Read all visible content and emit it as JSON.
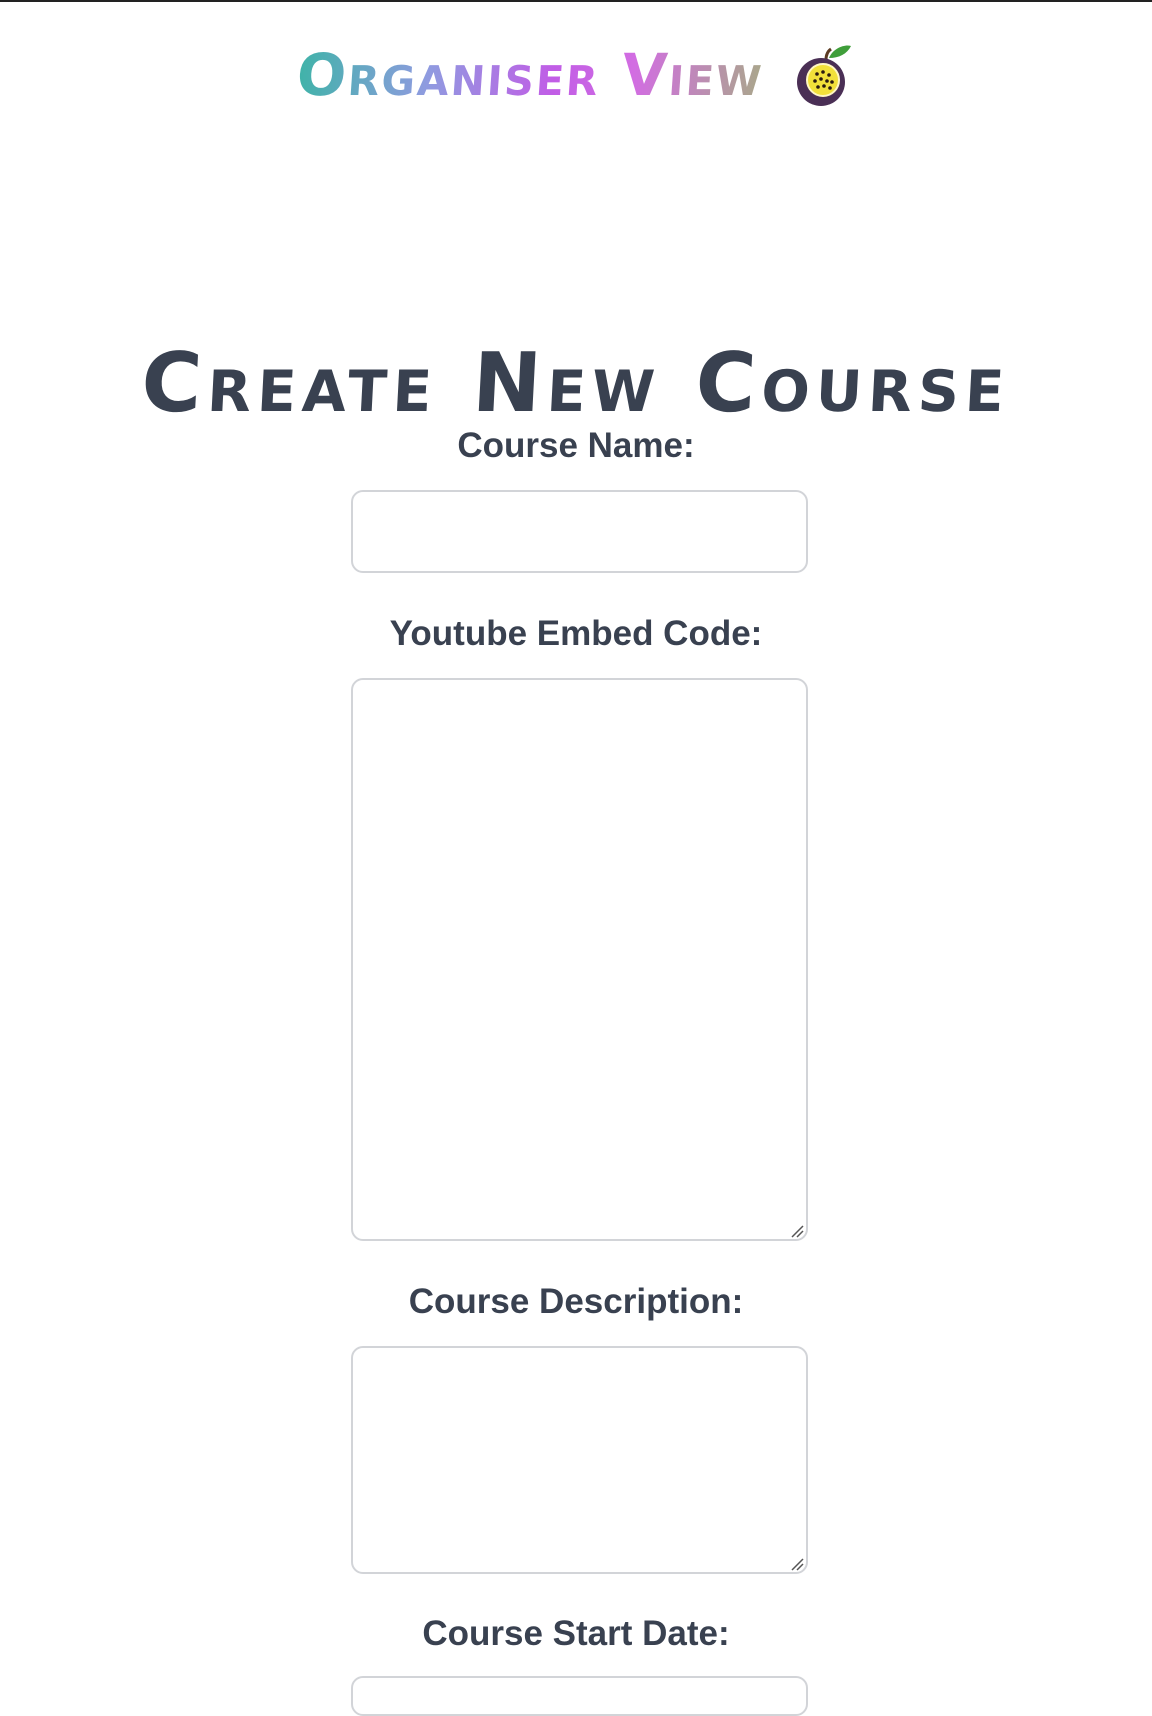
{
  "header": {
    "title": "Organiser View",
    "logo_icon": "passion-fruit-icon"
  },
  "page": {
    "title": "Create New Course"
  },
  "form": {
    "course_name": {
      "label": "Course Name:",
      "value": ""
    },
    "youtube_embed": {
      "label": "Youtube Embed Code:",
      "value": ""
    },
    "course_description": {
      "label": "Course Description:",
      "value": ""
    },
    "course_start_date": {
      "label": "Course Start Date:",
      "value": ""
    }
  },
  "colors": {
    "text": "#394150",
    "border": "#d2d4d8",
    "title_gradient": [
      "#3fb3a8",
      "#8f9be0",
      "#c15de6",
      "#a9a88a"
    ]
  }
}
